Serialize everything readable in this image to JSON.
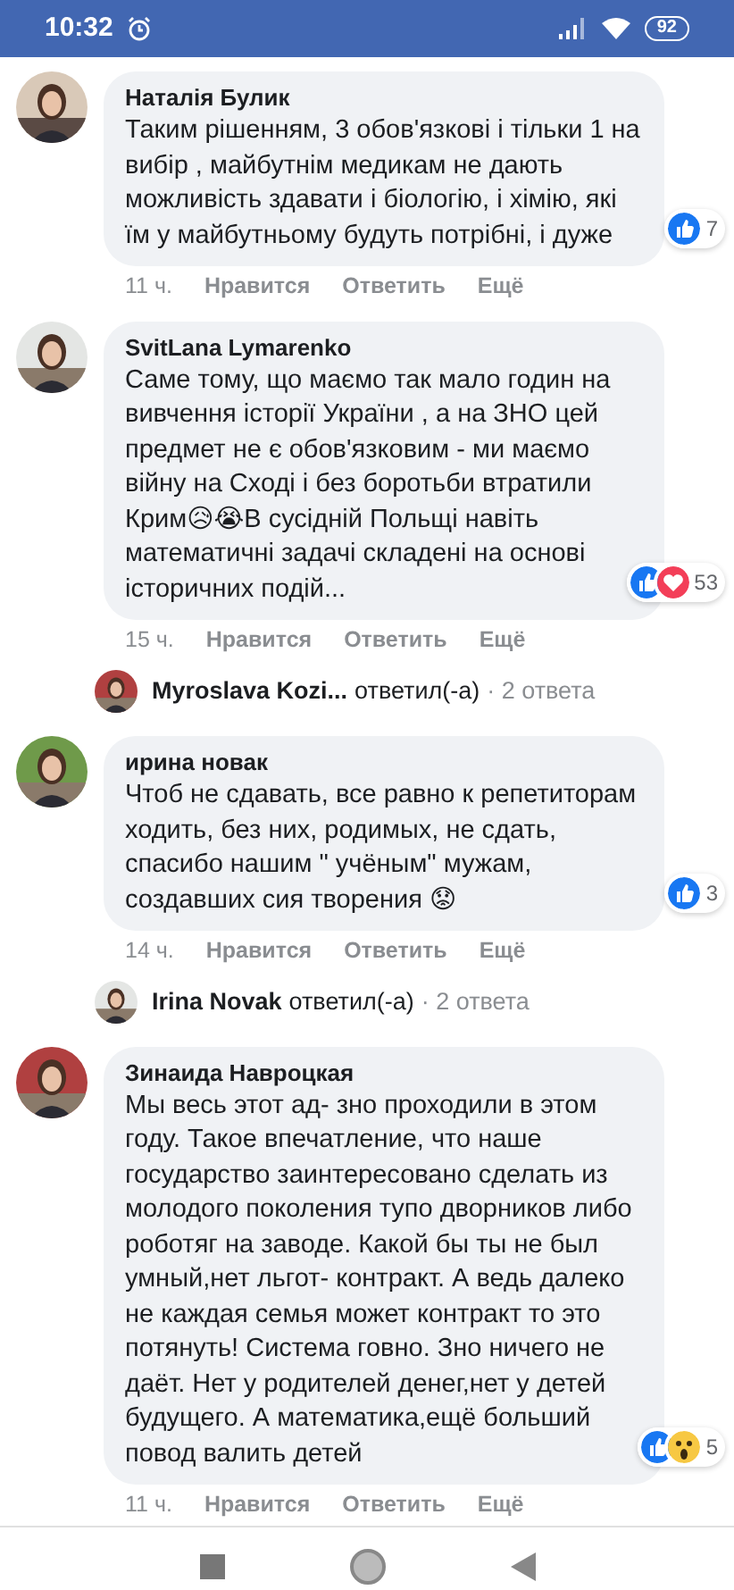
{
  "status_bar": {
    "time": "10:32",
    "battery": "92"
  },
  "thread": [
    {
      "kind": "comment",
      "author": "Наталія Булик",
      "text": "Таким рішенням, 3 обов'язкові і тільки 1 на вибір , майбутнім медикам не дають можливість здавати і біологію, і хімію, які їм у майбутньому будуть потрібні, і дуже",
      "reactions": [
        {
          "kind": "like"
        }
      ],
      "reaction_count": "7",
      "time": "11 ч.",
      "actions": [
        "Нравится",
        "Ответить",
        "Ещё"
      ]
    },
    {
      "kind": "comment",
      "author": "SvitLana Lymarenko",
      "text": "Саме тому, що маємо так мало годин на вивчення історії України , а на ЗНО цей предмет не є обов'язковим - ми маємо війну на Сході і без боротьби втратили Крим😥😭В сусідній Польщі навіть математичні задачі складені на основі історичних подій...",
      "reactions": [
        {
          "kind": "like"
        },
        {
          "kind": "love"
        }
      ],
      "reaction_count": "53",
      "time": "15 ч.",
      "actions": [
        "Нравится",
        "Ответить",
        "Ещё"
      ]
    },
    {
      "kind": "reply",
      "author": "Myroslava Kozi...",
      "verb": "ответил(-а)",
      "count": "· 2 ответа"
    },
    {
      "kind": "comment",
      "author": "ирина новак",
      "text": "Чтоб не сдавать, все равно к репетиторам ходить, без них, родимых, не сдать, спасибо нашим \" учёным\" мужам, создавших сия творения 😟",
      "reactions": [
        {
          "kind": "like"
        }
      ],
      "reaction_count": "3",
      "time": "14 ч.",
      "actions": [
        "Нравится",
        "Ответить",
        "Ещё"
      ]
    },
    {
      "kind": "reply",
      "author": "Irina Novak",
      "verb": "ответил(-а)",
      "count": "· 2 ответа"
    },
    {
      "kind": "comment",
      "author": "Зинаида Навроцкая",
      "text": "Мы весь этот ад- зно проходили в этом году. Такое впечатление, что наше государство заинтересовано сделать из молодого поколения тупо дворников либо роботяг на заводе. Какой бы ты не был умный,нет льгот- контракт. А ведь далеко не каждая семья может контракт то это потянуть! Система говно. Зно ничего не даёт. Нет у родителей денег,нет у детей будущего. А математика,ещё больший повод валить детей",
      "reactions": [
        {
          "kind": "like"
        },
        {
          "kind": "wow"
        }
      ],
      "reaction_count": "5",
      "time": "11 ч.",
      "actions": [
        "Нравится",
        "Ответить",
        "Ещё"
      ]
    }
  ]
}
